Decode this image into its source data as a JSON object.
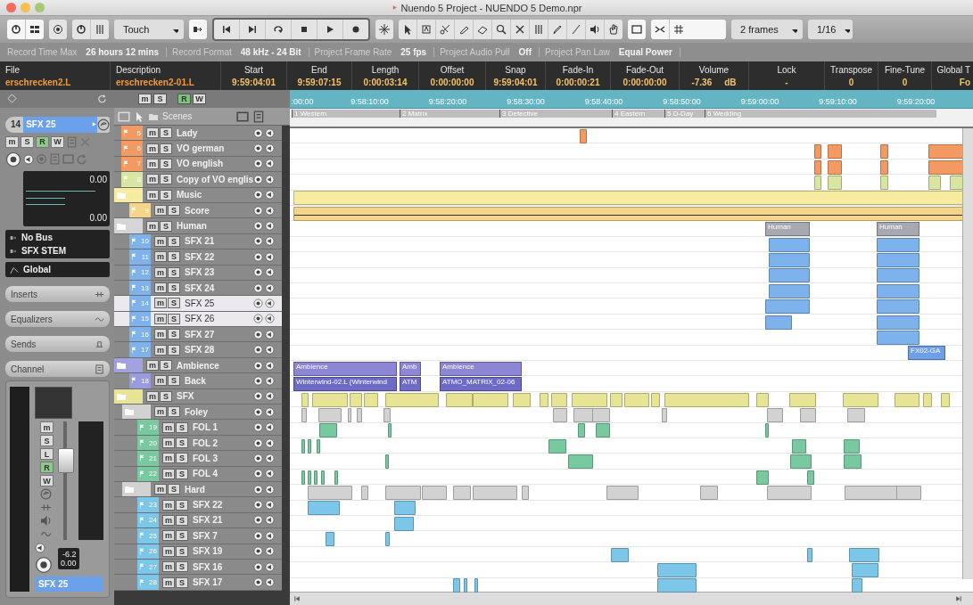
{
  "window": {
    "title": "Nuendo 5 Project - NUENDO 5 Demo.npr"
  },
  "toolbar": {
    "automation_mode": "Touch",
    "grid": "2 frames",
    "quantize": "1/16"
  },
  "status_line": [
    {
      "label": "Record Time Max",
      "value": "26 hours 12 mins"
    },
    {
      "label": "Record Format",
      "value": "48 kHz - 24 Bit"
    },
    {
      "label": "Project Frame Rate",
      "value": "25 fps"
    },
    {
      "label": "Project Audio Pull",
      "value": "Off"
    },
    {
      "label": "Project Pan Law",
      "value": "Equal Power"
    }
  ],
  "info_line": [
    {
      "label": "File",
      "value": "erschrecken2.L",
      "kind": "name"
    },
    {
      "label": "Description",
      "value": "erschrecken2-01.L",
      "kind": "name"
    },
    {
      "label": "Start",
      "value": "9:59:04:01",
      "kind": "value"
    },
    {
      "label": "End",
      "value": "9:59:07:15",
      "kind": "value"
    },
    {
      "label": "Length",
      "value": "0:00:03:14",
      "kind": "value"
    },
    {
      "label": "Offset",
      "value": "0:00:00:00",
      "kind": "value"
    },
    {
      "label": "Snap",
      "value": "9:59:04:01",
      "kind": "value"
    },
    {
      "label": "Fade-In",
      "value": "0:00:00:21",
      "kind": "value"
    },
    {
      "label": "Fade-Out",
      "value": "0:00:00:00",
      "kind": "value"
    },
    {
      "label": "Volume",
      "value": "-7.36",
      "unit": "dB",
      "kind": "value"
    },
    {
      "label": "Lock",
      "value": "-",
      "kind": "value"
    },
    {
      "label": "Transpose",
      "value": "0",
      "kind": "value"
    },
    {
      "label": "Fine-Tune",
      "value": "0",
      "kind": "value"
    },
    {
      "label": "Global T",
      "value": "Fo",
      "kind": "value"
    }
  ],
  "inspector": {
    "track_number": "14",
    "track_name": "SFX 25",
    "buttons": [
      {
        "label": "m",
        "on": false
      },
      {
        "label": "S",
        "on": false
      },
      {
        "label": "R",
        "on": true
      },
      {
        "label": "W",
        "on": false
      }
    ],
    "volume": "0.00",
    "pan": "0.00",
    "routing": [
      "No Bus",
      "SFX STEM"
    ],
    "automation": "Global",
    "sections": [
      "Inserts",
      "Equalizers",
      "Sends",
      "Channel"
    ],
    "channel": {
      "buttons": [
        {
          "label": "m",
          "on": false
        },
        {
          "label": "S",
          "on": false
        },
        {
          "label": "L",
          "on": false
        },
        {
          "label": "R",
          "on": true
        },
        {
          "label": "W",
          "on": false
        }
      ],
      "peak": "-6.2",
      "volume": "0.00",
      "name": "SFX 25"
    }
  },
  "track_header": {
    "buttons": [
      {
        "label": "m",
        "on": false
      },
      {
        "label": "S",
        "on": false
      },
      {
        "label": "R",
        "on": true
      },
      {
        "label": "W",
        "on": false
      }
    ],
    "title": "Scenes"
  },
  "tracks": [
    {
      "kind": "audio",
      "number": "5",
      "name": "Lady",
      "color": "#f29a62",
      "selected": false,
      "buttons": [
        "m",
        "S"
      ]
    },
    {
      "kind": "audio",
      "number": "6",
      "name": "VO german",
      "color": "#f29a62",
      "selected": false,
      "buttons": [
        "m",
        "S"
      ]
    },
    {
      "kind": "audio",
      "number": "7",
      "name": "VO english",
      "color": "#f29a62",
      "selected": false,
      "buttons": [
        "m",
        "S"
      ]
    },
    {
      "kind": "audio",
      "number": "8",
      "name": "Copy of VO englis",
      "color": "#d9e6a2",
      "selected": false,
      "buttons": [
        "m",
        "S"
      ]
    },
    {
      "kind": "folder",
      "name": "Music",
      "color": "#f7eba0",
      "selected": false,
      "buttons": [
        "m",
        "S"
      ],
      "children": [
        {
          "kind": "audio",
          "number": "9",
          "name": "Score",
          "color": "#f5d58a",
          "selected": false,
          "buttons": [
            "m",
            "S"
          ]
        }
      ]
    },
    {
      "kind": "folder",
      "name": "Human",
      "color": "#d5d5d5",
      "selected": false,
      "buttons": [
        "m",
        "S"
      ],
      "events": [
        {
          "label": "Human"
        },
        {
          "label": "Human"
        }
      ],
      "children": [
        {
          "kind": "audio",
          "number": "10",
          "name": "SFX 21",
          "color": "#7eb2ec",
          "selected": false,
          "buttons": [
            "m",
            "S"
          ]
        },
        {
          "kind": "audio",
          "number": "11",
          "name": "SFX 22",
          "color": "#7eb2ec",
          "selected": false,
          "buttons": [
            "m",
            "S"
          ]
        },
        {
          "kind": "audio",
          "number": "12",
          "name": "SFX 23",
          "color": "#7eb2ec",
          "selected": false,
          "buttons": [
            "m",
            "S"
          ]
        },
        {
          "kind": "audio",
          "number": "13",
          "name": "SFX 24",
          "color": "#7eb2ec",
          "selected": false,
          "buttons": [
            "m",
            "S"
          ]
        },
        {
          "kind": "audio",
          "number": "14",
          "name": "SFX 25",
          "color": "#7eb2ec",
          "selected": true,
          "buttons": [
            "m",
            "S"
          ]
        },
        {
          "kind": "audio",
          "number": "15",
          "name": "SFX 26",
          "color": "#7eb2ec",
          "selected": true,
          "buttons": [
            "m",
            "S"
          ]
        },
        {
          "kind": "audio",
          "number": "16",
          "name": "SFX 27",
          "color": "#7eb2ec",
          "selected": false,
          "buttons": [
            "m",
            "S"
          ]
        },
        {
          "kind": "audio",
          "number": "17",
          "name": "SFX 28",
          "color": "#7eb2ec",
          "selected": false,
          "buttons": [
            "m",
            "S"
          ],
          "events": [
            {
              "label": "FX02-GA"
            }
          ]
        }
      ]
    },
    {
      "kind": "folder",
      "name": "Ambience",
      "color": "#a2a2e0",
      "selected": false,
      "buttons": [
        "m",
        "S"
      ],
      "events": [
        {
          "label": "Ambience"
        },
        {
          "label": "Amb"
        },
        {
          "label": "Ambience"
        }
      ],
      "children": [
        {
          "kind": "audio",
          "number": "18",
          "name": "Back",
          "color": "#9a9ae0",
          "selected": false,
          "buttons": [
            "m",
            "S"
          ],
          "events": [
            {
              "label": "Winterwind-02.L (Winterwind"
            },
            {
              "label": "ATM"
            },
            {
              "label": "ATMO_MATRIX_02-06"
            }
          ]
        }
      ]
    },
    {
      "kind": "folder",
      "name": "SFX",
      "color": "#e8e496",
      "selected": false,
      "buttons": [
        "m",
        "S"
      ],
      "children": [
        {
          "kind": "folder",
          "name": "Foley",
          "color": "#d2d2d2",
          "selected": false,
          "buttons": [
            "m",
            "S"
          ],
          "children": [
            {
              "kind": "audio",
              "number": "19",
              "name": "FOL 1",
              "color": "#78c8a0",
              "selected": false,
              "buttons": [
                "m",
                "S"
              ]
            },
            {
              "kind": "audio",
              "number": "20",
              "name": "FOL 2",
              "color": "#78c8a0",
              "selected": false,
              "buttons": [
                "m",
                "S"
              ]
            },
            {
              "kind": "audio",
              "number": "21",
              "name": "FOL 3",
              "color": "#78c8a0",
              "selected": false,
              "buttons": [
                "m",
                "S"
              ]
            },
            {
              "kind": "audio",
              "number": "22",
              "name": "FOL 4",
              "color": "#78c8a0",
              "selected": false,
              "buttons": [
                "m",
                "S"
              ]
            }
          ]
        },
        {
          "kind": "folder",
          "name": "Hard",
          "color": "#d2d2d2",
          "selected": false,
          "buttons": [
            "m",
            "S"
          ],
          "children": [
            {
              "kind": "audio",
              "number": "23",
              "name": "SFX 22",
              "color": "#7cc6ea",
              "selected": false,
              "buttons": [
                "m",
                "S"
              ]
            },
            {
              "kind": "audio",
              "number": "24",
              "name": "SFX 21",
              "color": "#7cc6ea",
              "selected": false,
              "buttons": [
                "m",
                "S"
              ]
            },
            {
              "kind": "audio",
              "number": "25",
              "name": "SFX 7",
              "color": "#7cc6ea",
              "selected": false,
              "buttons": [
                "m",
                "S"
              ]
            },
            {
              "kind": "audio",
              "number": "26",
              "name": "SFX 19",
              "color": "#7cc6ea",
              "selected": false,
              "buttons": [
                "m",
                "S"
              ]
            },
            {
              "kind": "audio",
              "number": "27",
              "name": "SFX 16",
              "color": "#7cc6ea",
              "selected": false,
              "buttons": [
                "m",
                "S"
              ]
            },
            {
              "kind": "audio",
              "number": "28",
              "name": "SFX 17",
              "color": "#7cc6ea",
              "selected": false,
              "buttons": [
                "m",
                "S"
              ]
            }
          ]
        }
      ]
    }
  ],
  "ruler": {
    "ticks": [
      ":00:00",
      "9:58:10:00",
      "9:58:20:00",
      "9:58:30:00",
      "9:58:40:00",
      "9:58:50:00",
      "9:59:00:00",
      "9:59:10:00",
      "9:59:20:00"
    ]
  },
  "markers": [
    {
      "label": "1 Western"
    },
    {
      "label": "2 Matrix"
    },
    {
      "label": "3 Detective"
    },
    {
      "label": "4 Eastern"
    },
    {
      "label": "5 D-Day"
    },
    {
      "label": "6 Wedding"
    }
  ]
}
